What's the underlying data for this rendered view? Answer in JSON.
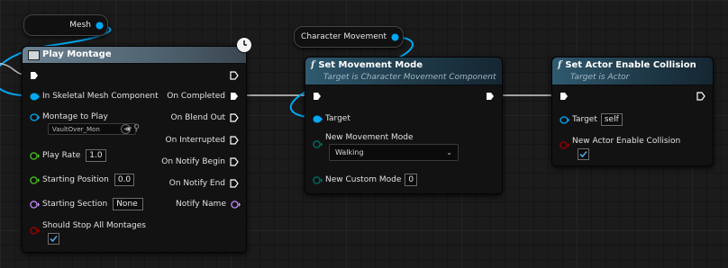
{
  "colors": {
    "object_pin": "#00a8f4",
    "float_pin": "#47c61a",
    "vector_pin": "#f0c000",
    "name_pin": "#c68cff",
    "bool_pin": "#a00000",
    "byte_pin": "#007368",
    "exec_pin": "#ffffff",
    "play_montage_header": "#6a7f8f",
    "function_header": "#2d5266",
    "wire_object": "#00a8f4",
    "wire_exec": "#d0d0d0"
  },
  "mesh_variable": {
    "label": "Mesh",
    "pin_icon": "object-pin-icon"
  },
  "character_movement_variable": {
    "label": "Character Movement",
    "pin_icon": "object-pin-icon"
  },
  "play_montage": {
    "title": "Play Montage",
    "header_icon": "montage-icon",
    "latent_icon": "clock-icon",
    "inputs": {
      "in_skeletal_mesh": "In Skeletal Mesh Component",
      "montage_to_play": "Montage to Play",
      "montage_value": "VaultOver_Mon",
      "play_rate": "Play Rate",
      "play_rate_value": "1.0",
      "starting_position": "Starting Position",
      "starting_position_value": "0.0",
      "starting_section": "Starting Section",
      "starting_section_value": "None",
      "should_stop_all": "Should Stop All Montages"
    },
    "outputs": {
      "on_completed": "On Completed",
      "on_blend_out": "On Blend Out",
      "on_interrupted": "On Interrupted",
      "on_notify_begin": "On Notify Begin",
      "on_notify_end": "On Notify End",
      "notify_name": "Notify Name"
    }
  },
  "set_movement_mode": {
    "title": "Set Movement Mode",
    "subtitle": "Target is Character Movement Component",
    "function_icon": "function-icon",
    "target_label": "Target",
    "new_movement_mode_label": "New Movement Mode",
    "new_movement_mode_value": "Walking",
    "new_custom_mode_label": "New Custom Mode",
    "new_custom_mode_value": "0"
  },
  "set_actor_enable_collision": {
    "title": "Set Actor Enable Collision",
    "subtitle": "Target is Actor",
    "function_icon": "function-icon",
    "target_label": "Target",
    "target_value": "self",
    "new_enable_collision_label": "New Actor Enable Collision"
  }
}
